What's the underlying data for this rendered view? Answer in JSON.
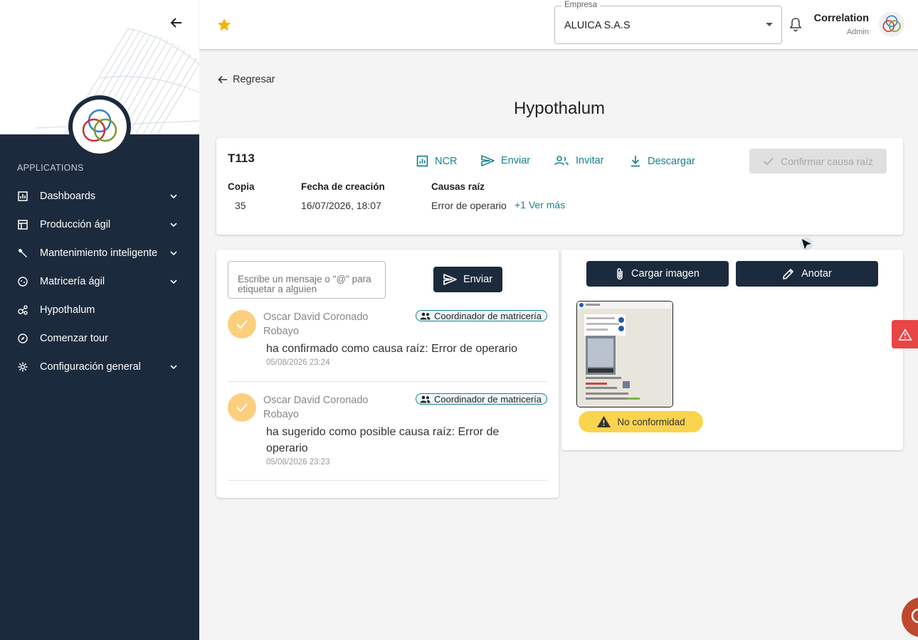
{
  "sidebar": {
    "section_label": "APPLICATIONS",
    "items": [
      {
        "label": "Dashboards",
        "icon": "bar-chart-icon",
        "expandable": true
      },
      {
        "label": "Producción ágil",
        "icon": "table-icon",
        "expandable": true
      },
      {
        "label": "Mantenimiento inteligente",
        "icon": "wrench-icon",
        "expandable": true
      },
      {
        "label": "Matricería ágil",
        "icon": "globe-icon",
        "expandable": true
      },
      {
        "label": "Hypothalum",
        "icon": "nodes-icon",
        "expandable": false
      },
      {
        "label": "Comenzar tour",
        "icon": "compass-icon",
        "expandable": false
      },
      {
        "label": "Configuración general",
        "icon": "gear-icon",
        "expandable": true
      }
    ]
  },
  "header": {
    "company_label": "Empresa",
    "company_value": "ALUICA S.A.S",
    "user_name": "Correlation",
    "user_role": "Admin"
  },
  "main": {
    "back_label": "Regresar",
    "title": "Hypothalum"
  },
  "ticket": {
    "id": "T113",
    "actions": {
      "ncr": "NCR",
      "send": "Enviar",
      "invite": "Invitar",
      "download": "Descargar",
      "confirm": "Confirmar causa raíz"
    },
    "fields": {
      "copy_label": "Copia",
      "copy_value": "35",
      "created_label": "Fecha de creación",
      "created_value": "16/07/2026, 18:07",
      "causes_label": "Causas raíz",
      "causes_value": "Error de operario",
      "see_more": "+1 Ver más"
    }
  },
  "chat": {
    "input_placeholder": "Escribe un mensaje o \"@\" para etiquetar a alguien",
    "send_label": "Enviar",
    "messages": [
      {
        "author": "Oscar David Coronado Robayo",
        "role": "Coordinador de matricería",
        "text": "ha confirmado como causa raíz: Error de operario",
        "time": "05/08/2026 23:24"
      },
      {
        "author": "Oscar David Coronado Robayo",
        "role": "Coordinador de matricería",
        "text": "ha sugerido como posible causa raíz: Error de operario",
        "time": "05/08/2026 23:23"
      }
    ]
  },
  "media": {
    "upload_label": "Cargar imagen",
    "annotate_label": "Anotar",
    "badge_label": "No conformidad"
  },
  "colors": {
    "sidebar_bg": "#1c2a3d",
    "accent_teal": "#17838f",
    "badge_yellow": "#fad44e",
    "check_orange": "#fbcf7e",
    "alert_red": "#e84545"
  }
}
